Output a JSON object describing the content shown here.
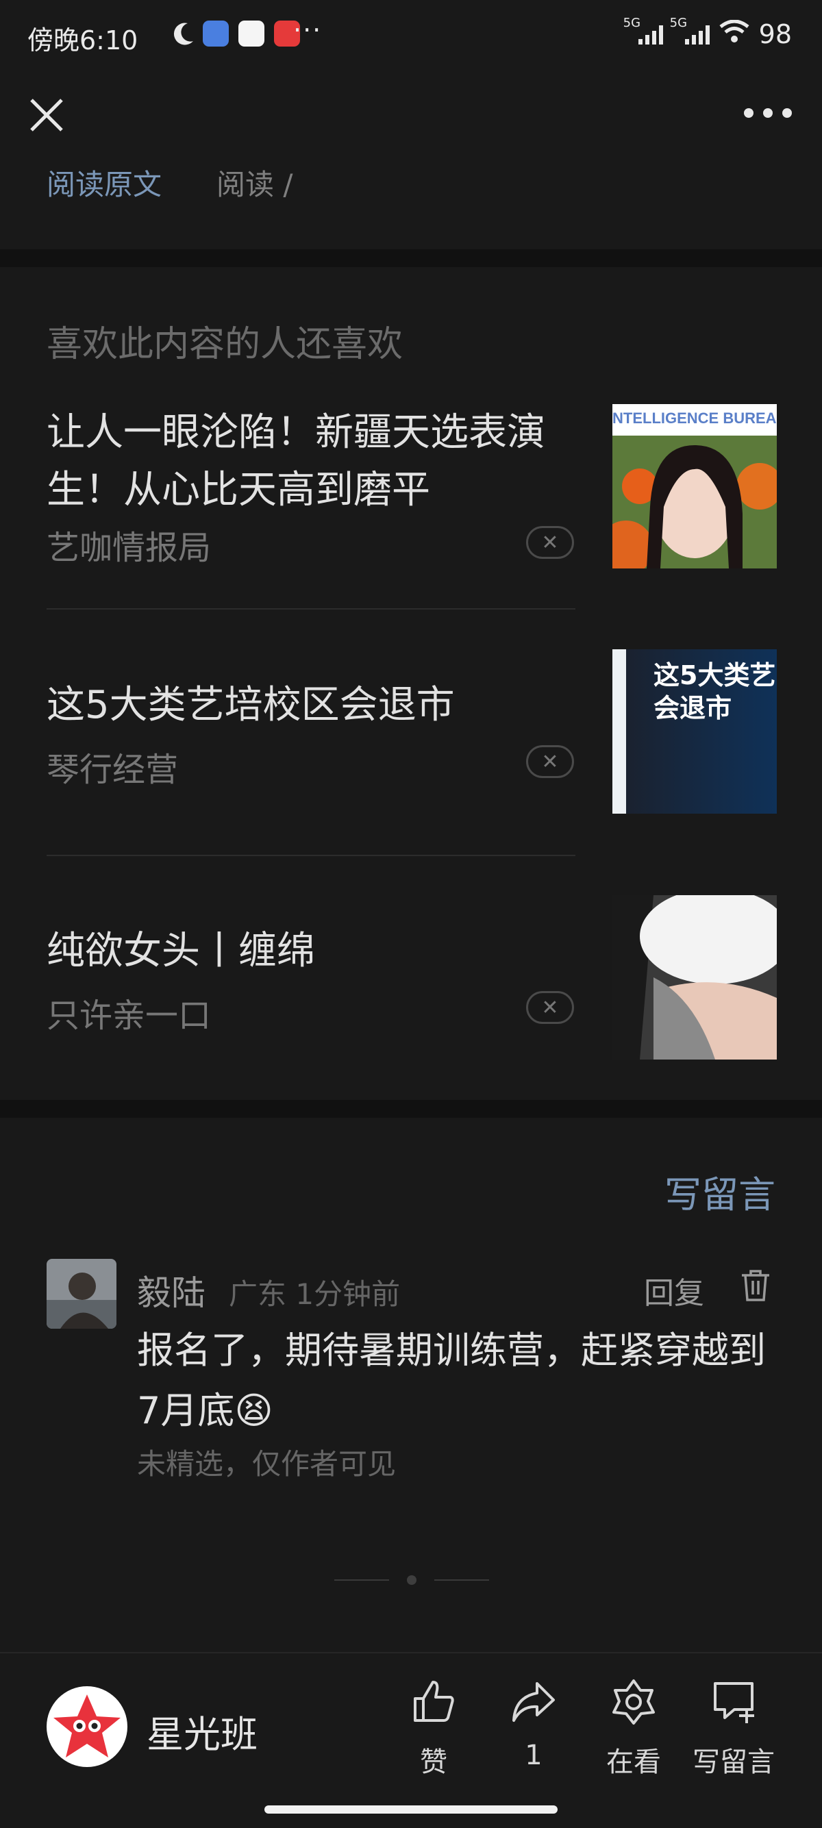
{
  "status_bar": {
    "time": "傍晚6:10",
    "more": "···",
    "net1": "5G",
    "net2": "5G",
    "battery": "98"
  },
  "article_footer": {
    "read_original": "阅读原文",
    "read_count": "阅读 /"
  },
  "recommend": {
    "title": "喜欢此内容的人还喜欢",
    "items": [
      {
        "title": "让人一眼沦陷！新疆天选表演生！从心比天高到磨平",
        "source": "艺咖情报局",
        "thumb_text": "NTELLIGENCE BUREAU"
      },
      {
        "title": "这5大类艺培校区会退市",
        "source": "琴行经营",
        "thumb_text": "这5大类艺会退市"
      },
      {
        "title": "纯欲女头丨缠绵",
        "source": "只许亲一口"
      }
    ]
  },
  "comments": {
    "write_link": "写留言",
    "items": [
      {
        "name": "毅陆",
        "meta": "广东 1分钟前",
        "reply": "回复",
        "text": "报名了，期待暑期训练营，赶紧穿越到7月底😫",
        "note": "未精选，仅作者可见"
      }
    ]
  },
  "bottom_bar": {
    "account_name": "星光班",
    "like_label": "赞",
    "share_count": "1",
    "watching_label": "在看",
    "comment_label": "写留言"
  },
  "colors": {
    "background": "#191919",
    "link": "#7b97b8",
    "brand_red": "#e8323c"
  },
  "icons": [
    "close-icon",
    "more-icon",
    "dismiss-icon",
    "delete-icon",
    "like-icon",
    "share-icon",
    "watching-icon",
    "comment-icon"
  ]
}
